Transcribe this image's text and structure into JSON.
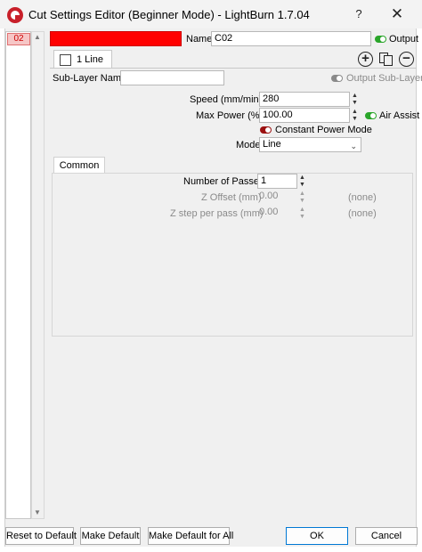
{
  "window": {
    "title": "Cut Settings Editor (Beginner Mode) - LightBurn 1.7.04",
    "help_label": "?",
    "close_label": "✕"
  },
  "layer_list": {
    "items": [
      {
        "label": "02",
        "color": "#ff0000"
      }
    ]
  },
  "header": {
    "name_label": "Name",
    "name_value": "C02",
    "output_label": "Output",
    "output_on": true
  },
  "sublayer_tabs": [
    {
      "label": "1 Line",
      "checked": false
    }
  ],
  "toolbar_icons": [
    "add-icon",
    "copy-icon",
    "remove-icon"
  ],
  "sublayer": {
    "name_label": "Sub-Layer Name",
    "name_value": "",
    "output_label": "Output Sub-Layer",
    "output_on": false
  },
  "settings": {
    "speed_label": "Speed (mm/min)",
    "speed_value": "280",
    "max_power_label": "Max Power  (%)",
    "max_power_value": "100.00",
    "air_assist_label": "Air Assist",
    "air_assist_on": true,
    "constant_power_label": "Constant Power Mode",
    "constant_power_on": false,
    "mode_label": "Mode",
    "mode_value": "Line"
  },
  "common": {
    "tab_label": "Common",
    "passes_label": "Number of Passes",
    "passes_value": "1",
    "z_offset_label": "Z Offset (mm)",
    "z_offset_value": "0.00",
    "z_offset_note": "(none)",
    "z_step_label": "Z step per pass (mm)",
    "z_step_value": "0.00",
    "z_step_note": "(none)"
  },
  "footer": {
    "reset_label": "Reset to Default",
    "make_default_label": "Make Default",
    "make_default_all_label": "Make Default for All",
    "ok_label": "OK",
    "cancel_label": "Cancel"
  },
  "colors": {
    "layer_color": "#ff0000",
    "toggle_on": "#2aa52a",
    "toggle_red": "#9b1010",
    "ok_border": "#0078d4"
  }
}
